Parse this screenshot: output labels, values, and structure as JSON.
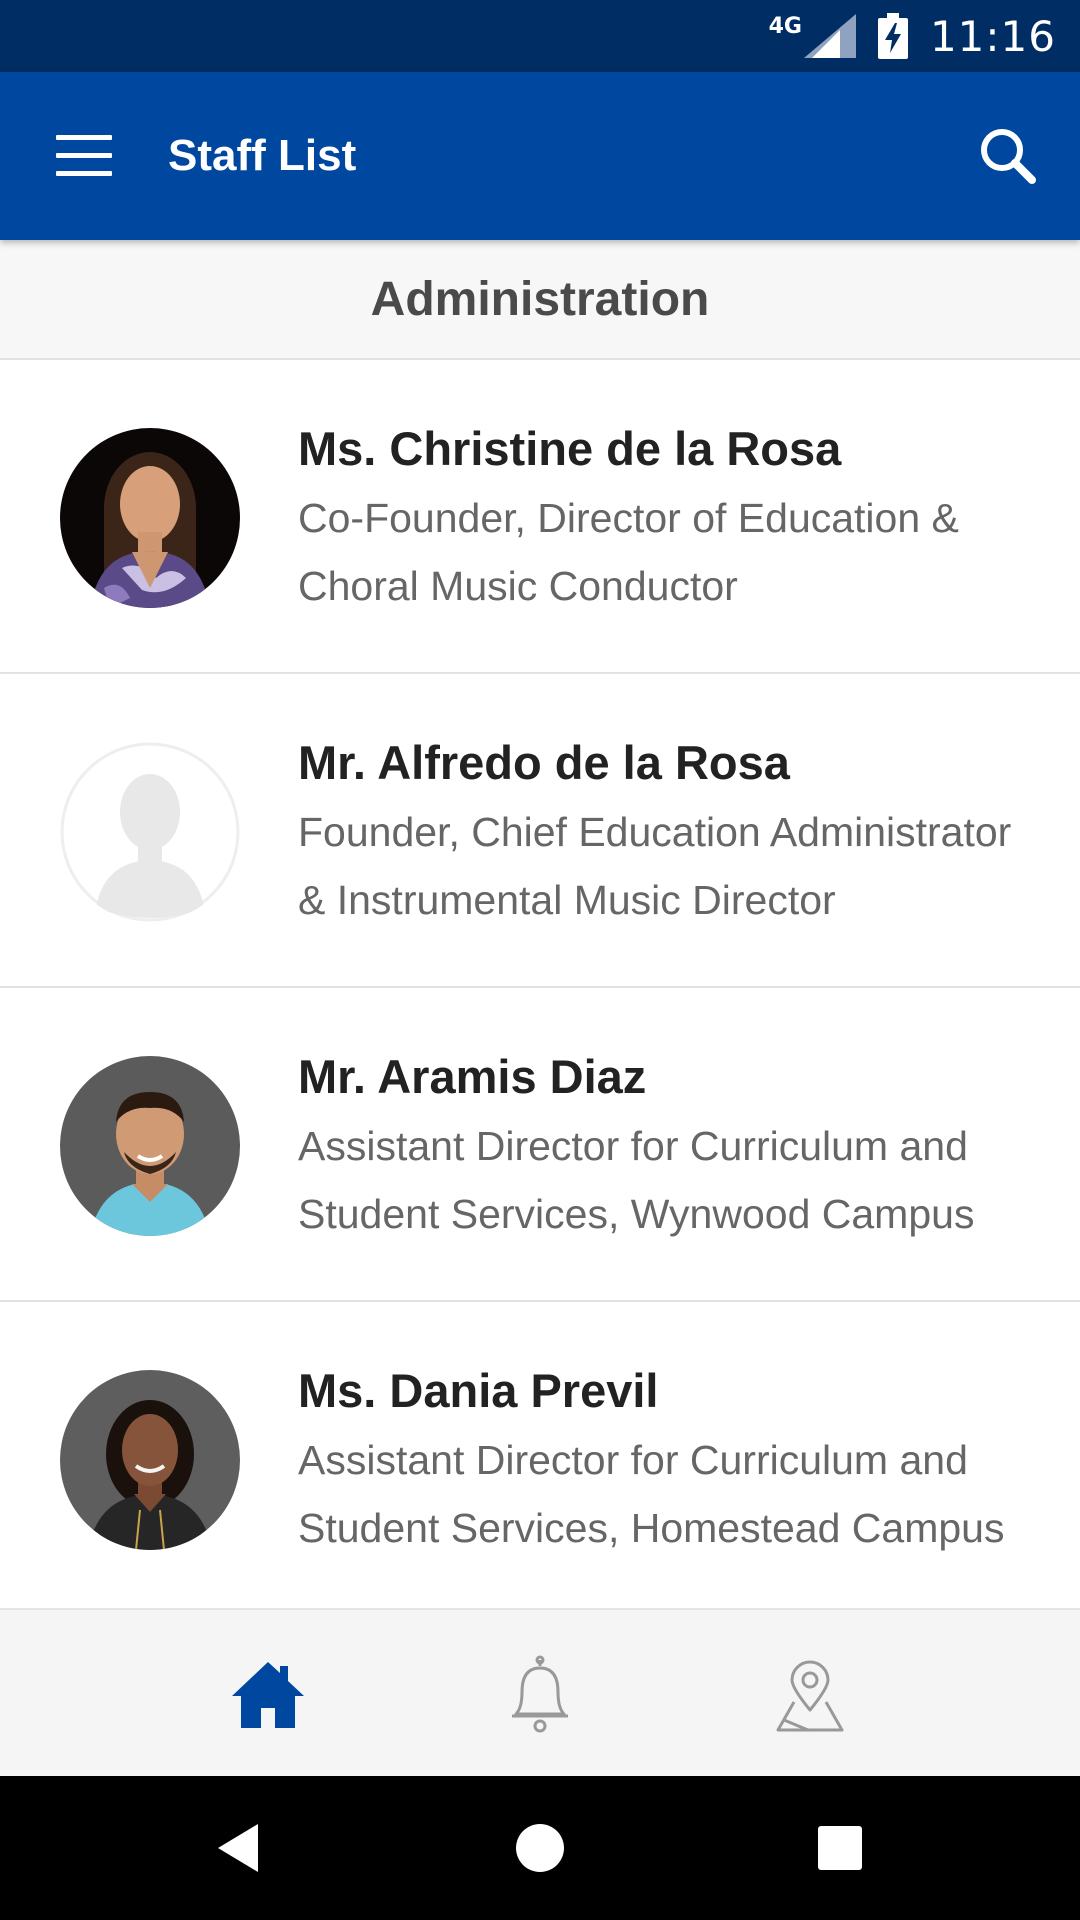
{
  "status_bar": {
    "network": "4G",
    "time": "11:16",
    "icons": [
      "signal-icon",
      "battery-charging-icon"
    ]
  },
  "app_bar": {
    "title": "Staff List",
    "icons": [
      "menu-icon",
      "search-icon"
    ]
  },
  "section": {
    "title": "Administration"
  },
  "staff": [
    {
      "name": "Ms. Christine de la Rosa",
      "role": "Co-Founder, Director of Education & Choral Music Conductor",
      "avatar": "photo"
    },
    {
      "name": "Mr. Alfredo de la Rosa",
      "role": "Founder, Chief Education Administrator & Instrumental Music Director",
      "avatar": "placeholder"
    },
    {
      "name": "Mr. Aramis Diaz",
      "role": "Assistant Director for Curriculum and Student Services, Wynwood Campus",
      "avatar": "photo"
    },
    {
      "name": "Ms. Dania Previl",
      "role": "Assistant Director for Curriculum and Student Services, Homestead Campus",
      "avatar": "photo"
    }
  ],
  "bottom_nav": {
    "items": [
      "home-icon",
      "bell-icon",
      "map-pin-icon"
    ],
    "active": "home-icon"
  },
  "colors": {
    "status_bar": "#002d64",
    "app_bar": "#0047a0",
    "accent": "#0047a0",
    "inactive_icon": "#999999"
  }
}
